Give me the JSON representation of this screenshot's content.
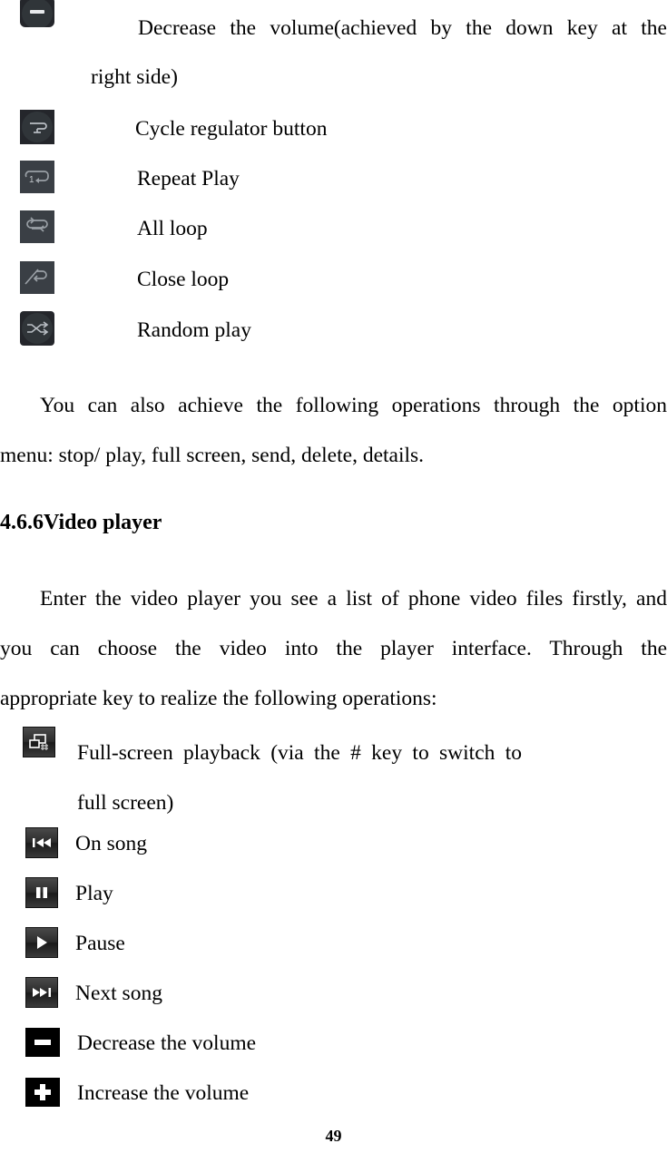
{
  "document": {
    "page_number": "49",
    "section_heading": "4.6.6Video player"
  },
  "music_controls": [
    {
      "icon": "volume-decrease-icon",
      "label": "Decrease the volume(achieved by the down key at the",
      "label_line2": "right side)"
    },
    {
      "icon": "cycle-regulator-icon",
      "label": "Cycle regulator button"
    },
    {
      "icon": "repeat-play-icon",
      "label": "Repeat Play"
    },
    {
      "icon": "all-loop-icon",
      "label": "All loop"
    },
    {
      "icon": "close-loop-icon",
      "label": "Close loop"
    },
    {
      "icon": "random-play-icon",
      "label": "Random play"
    }
  ],
  "option_menu_paragraph": {
    "line1": "You can also achieve the following operations through the option",
    "line2": "menu: stop/ play, full screen, send, delete, details."
  },
  "video_player_paragraph": {
    "line1": "Enter the video player you see a list of phone video files firstly, and",
    "line2": "you can choose the video into the player interface. Through the",
    "line3": "appropriate key to realize the following operations:"
  },
  "video_controls": [
    {
      "icon": "fullscreen-playback-icon",
      "label": "Full-screen playback (via the # key to switch to",
      "label_line2": "full screen)"
    },
    {
      "icon": "previous-song-icon",
      "label": "On song"
    },
    {
      "icon": "play-icon",
      "label": "Play"
    },
    {
      "icon": "pause-icon",
      "label": "Pause"
    },
    {
      "icon": "next-song-icon",
      "label": "Next song"
    },
    {
      "icon": "volume-down-icon",
      "label": "Decrease the volume"
    },
    {
      "icon": "volume-up-icon",
      "label": "Increase the volume"
    }
  ],
  "colors": {
    "page_background": "#ffffff",
    "text": "#000000",
    "icon_dark_grey": "#34393f",
    "icon_round_dark": "#24262b",
    "icon_black": "#000000",
    "icon_glyph_light": "#d5d8dc"
  }
}
